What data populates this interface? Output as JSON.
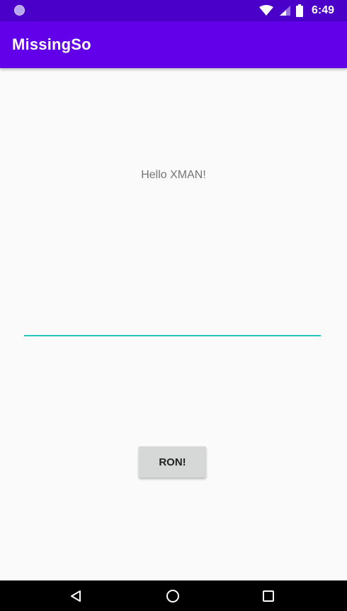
{
  "status_bar": {
    "time": "6:49",
    "icons": [
      "notification-dot-icon",
      "wifi-icon",
      "cell-signal-icon",
      "battery-icon"
    ]
  },
  "app_bar": {
    "title": "MissingSo"
  },
  "main": {
    "greeting": "Hello XMAN!",
    "input_value": "",
    "button_label": "RON!"
  },
  "nav_bar": {
    "icons": [
      "back-icon",
      "home-icon",
      "recents-icon"
    ]
  },
  "colors": {
    "status_bar": "#4a00c8",
    "app_bar": "#6200ea",
    "input_underline": "#26c6bd",
    "button_bg": "#d6d7d7",
    "background": "#fafafa"
  }
}
